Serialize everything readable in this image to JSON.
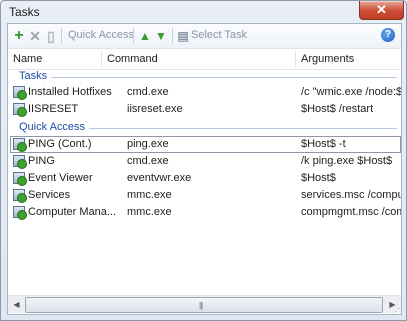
{
  "window": {
    "title": "Tasks",
    "close_glyph": "✕"
  },
  "toolbar": {
    "add_icon": "+",
    "delete_icon": "✕",
    "copy_icon": "▯",
    "quick_access_label": "Quick Access",
    "move_up_icon": "▲",
    "move_down_icon": "▼",
    "select_task_icon": "▤",
    "select_task_label": "Select Task",
    "help_icon": "?"
  },
  "columns": {
    "name": "Name",
    "command": "Command",
    "arguments": "Arguments"
  },
  "groups": {
    "tasks": {
      "label": "Tasks",
      "rows": [
        {
          "name": "Installed Hotfixes",
          "command": "cmd.exe",
          "arguments": "/c \"wmic.exe /node:$H"
        },
        {
          "name": "IISRESET",
          "command": "iisreset.exe",
          "arguments": "$Host$ /restart"
        }
      ]
    },
    "quick_access": {
      "label": "Quick Access",
      "rows": [
        {
          "name": "PING (Cont.)",
          "command": "ping.exe",
          "arguments": "$Host$ -t"
        },
        {
          "name": "PING",
          "command": "cmd.exe",
          "arguments": "/k ping.exe $Host$"
        },
        {
          "name": "Event Viewer",
          "command": "eventvwr.exe",
          "arguments": "$Host$"
        },
        {
          "name": "Services",
          "command": "mmc.exe",
          "arguments": "services.msc /compute"
        },
        {
          "name": "Computer Mana...",
          "command": "mmc.exe",
          "arguments": "compmgmt.msc /comp"
        }
      ]
    }
  },
  "scrollbar": {
    "left_arrow": "◀",
    "right_arrow": "▶",
    "grip": "|||"
  },
  "colors": {
    "accent": "#1e4fa3",
    "add": "#2f9a2f",
    "arrows": "#3c9a2e",
    "close": "#c94a33"
  }
}
